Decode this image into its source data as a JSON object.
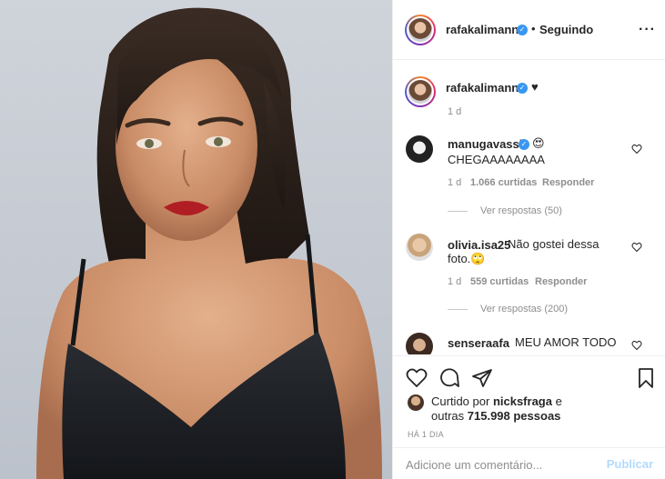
{
  "post": {
    "author": "rafakalimann",
    "follow_status": "Seguindo",
    "separator": "•",
    "more_icon": "more-options-icon"
  },
  "caption": {
    "author": "rafakalimann",
    "text": "♥",
    "time": "1 d"
  },
  "comments": [
    {
      "author": "manugavassi",
      "verified": true,
      "emoji": "😍",
      "text": "CHEGAAAAAAAA",
      "time": "1 d",
      "likes": "1.066 curtidas",
      "reply": "Responder",
      "view_replies": "Ver respostas (50)"
    },
    {
      "author": "olivia.isa25",
      "verified": false,
      "text": "Não gostei dessa",
      "text2": "foto.🙄",
      "time": "1 d",
      "likes": "559 curtidas",
      "reply": "Responder",
      "view_replies": "Ver respostas (200)"
    },
    {
      "author": "senseraafa",
      "verified": false,
      "text": "MEU AMOR TODO"
    }
  ],
  "likes": {
    "prefix": "Curtido por",
    "user": "nicksfraga",
    "suffix": "e",
    "line2_prefix": "outras",
    "count": "715.998 pessoas"
  },
  "date": "HÁ 1 DIA",
  "add_comment": {
    "placeholder": "Adicione um comentário...",
    "publish": "Publicar"
  },
  "colors": {
    "accent": "#3897f0",
    "publish_disabled": "#b3dbff",
    "lips": "#b01e24"
  }
}
